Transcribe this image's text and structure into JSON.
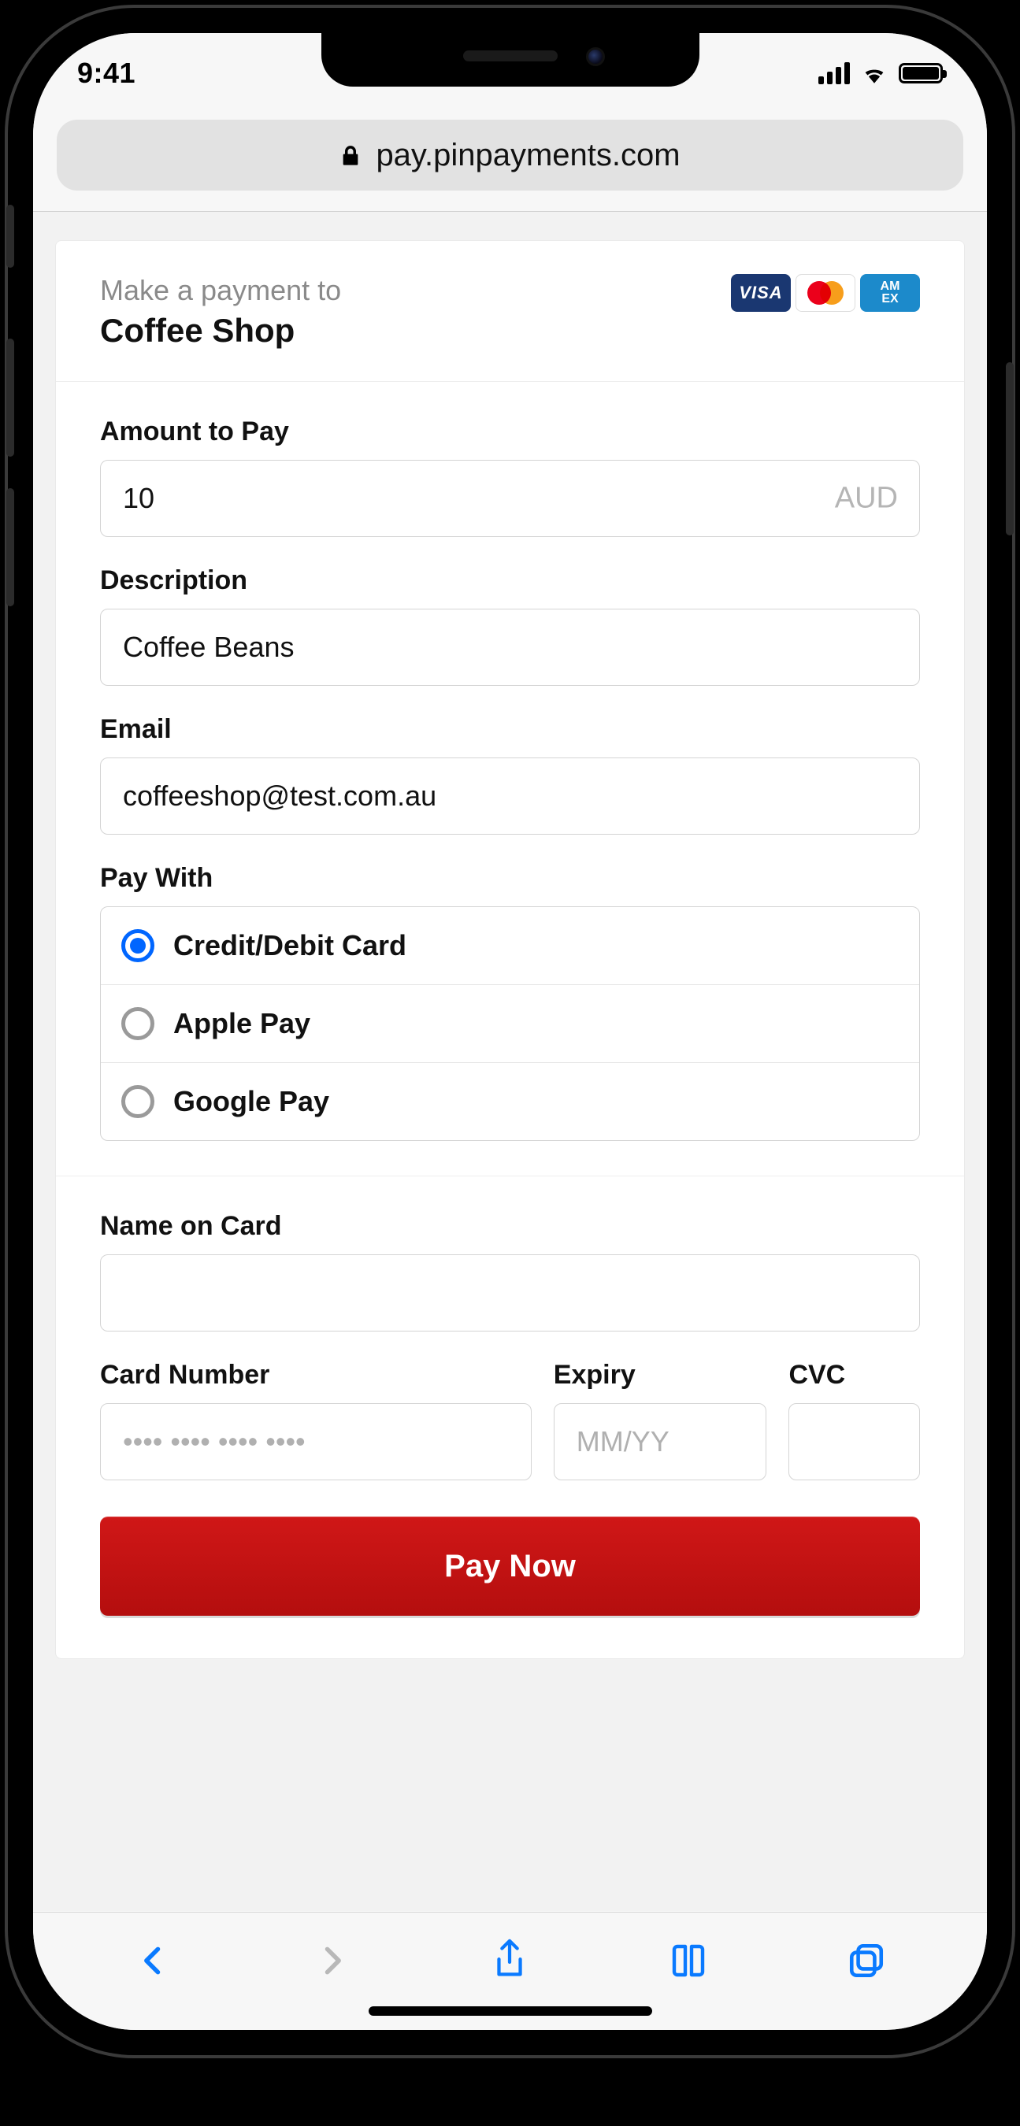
{
  "status": {
    "time": "9:41"
  },
  "browser": {
    "url": "pay.pinpayments.com"
  },
  "header": {
    "intro": "Make a payment to",
    "merchant": "Coffee Shop",
    "cards": {
      "visa": "VISA",
      "amex_top": "AM",
      "amex_bot": "EX"
    }
  },
  "form": {
    "amount_label": "Amount to Pay",
    "amount_value": "10",
    "amount_currency": "AUD",
    "description_label": "Description",
    "description_value": "Coffee Beans",
    "email_label": "Email",
    "email_value": "coffeeshop@test.com.au",
    "paywith_label": "Pay With",
    "paywith_options": {
      "card": "Credit/Debit Card",
      "apple": "Apple Pay",
      "google": "Google Pay"
    },
    "name_label": "Name on Card",
    "name_value": "",
    "cardnumber_label": "Card Number",
    "cardnumber_placeholder": "•••• •••• •••• ••••",
    "expiry_label": "Expiry",
    "expiry_placeholder": "MM/YY",
    "cvc_label": "CVC",
    "pay_button": "Pay Now"
  }
}
